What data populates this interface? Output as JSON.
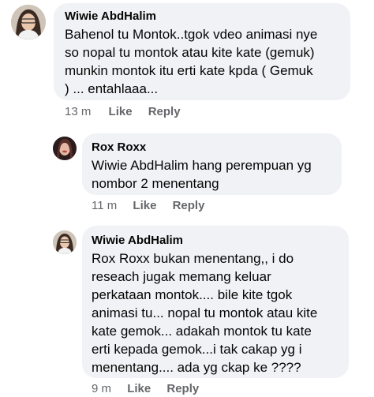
{
  "comments": [
    {
      "author": "Wiwie AbdHalim",
      "lines": [
        "Bahenol tu Montok..tgok vdeo animasi nye",
        "so nopal tu montok atau kite kate (gemuk)",
        "munkin montok itu erti kate kpda ( Gemuk",
        ") ... entahlaaa..."
      ],
      "time": "13 m",
      "like": "Like",
      "reply": "Reply",
      "avatar_icon": "profile-photo"
    },
    {
      "author": "Rox Roxx",
      "lines": [
        "Wiwie AbdHalim hang perempuan yg",
        "nombor 2 menentang"
      ],
      "time": "11 m",
      "like": "Like",
      "reply": "Reply",
      "avatar_icon": "profile-photo"
    },
    {
      "author": "Wiwie AbdHalim",
      "lines": [
        "Rox Roxx bukan menentang,, i do",
        "reseach jugak memang keluar",
        "perkataan montok.... bile kite tgok",
        "animasi tu... nopal tu montok atau kite",
        "kate gemok... adakah montok tu kate",
        "erti kepada gemok...i tak cakap yg i",
        "menentang.... ada yg ckap ke ????"
      ],
      "time": "9 m",
      "like": "Like",
      "reply": "Reply",
      "avatar_icon": "profile-photo"
    }
  ],
  "colors": {
    "bubble": "#f0f2f5",
    "text": "#050505",
    "meta": "#65676b"
  }
}
